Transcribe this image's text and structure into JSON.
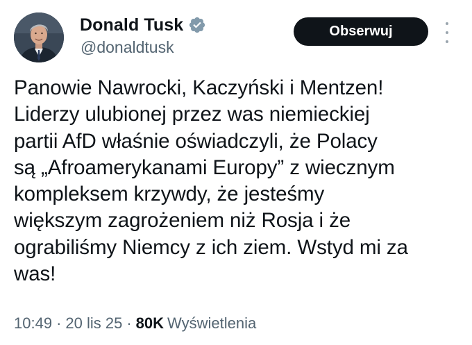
{
  "author": {
    "display_name": "Donald Tusk",
    "handle": "@donaldtusk",
    "verified_icon": "verified-badge-icon"
  },
  "actions": {
    "follow_label": "Obserwuj",
    "more_icon": "more-vertical-icon"
  },
  "tweet": {
    "text": "Panowie Nawrocki, Kaczyński i Mentzen!\nLiderzy ulubionej przez was niemieckiej\npartii AfD właśnie oświadczyli, że Polacy\nsą „Afroamerykanami Europy” z wiecznym\nkompleksem krzywdy, że jesteśmy\nwiększym zagrożeniem niż Rosja i że\nograbiliśmy Niemcy z ich ziem. Wstyd mi za\nwas!"
  },
  "meta": {
    "time": "10:49",
    "separator": "·",
    "date": "20 lis 25",
    "views_count": "80K",
    "views_label": "Wyświetlenia"
  },
  "colors": {
    "text_primary": "#0f1419",
    "text_secondary": "#536471",
    "verified_badge": "#829aab",
    "button_bg": "#0f1419",
    "background": "#ffffff"
  }
}
